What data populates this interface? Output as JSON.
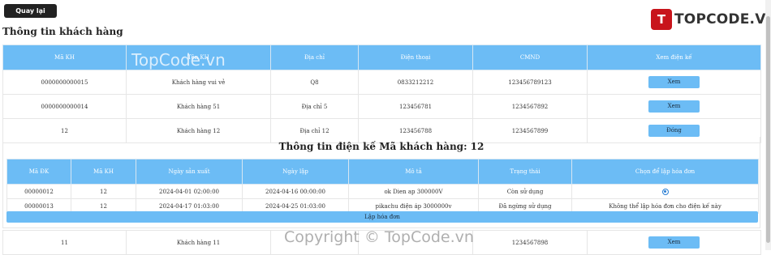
{
  "header": {
    "back_label": "Quay lại",
    "logo_mark": "T",
    "logo_text": "TOPCODE.VN",
    "page_title": "Thông tin khách hàng"
  },
  "customer_table": {
    "columns": [
      "Mã KH",
      "Tên KH",
      "Địa chỉ",
      "Điện thoại",
      "CMND",
      "Xem điện kế"
    ],
    "rows": [
      {
        "id": "0000000000015",
        "name": "Khách hàng vui vẻ",
        "address": "Q8",
        "phone": "0833212212",
        "cmnd": "123456789123",
        "action": "Xem"
      },
      {
        "id": "0000000000014",
        "name": "Khách hàng 51",
        "address": "Địa chỉ 5",
        "phone": "123456781",
        "cmnd": "1234567892",
        "action": "Xem"
      },
      {
        "id": "12",
        "name": "Khách hàng 12",
        "address": "Địa chỉ 12",
        "phone": "123456788",
        "cmnd": "1234567899",
        "action": "Đóng"
      }
    ],
    "last_row": {
      "id": "11",
      "name": "Khách hàng 11",
      "address": "",
      "phone": "",
      "cmnd": "1234567898",
      "action": "Xem"
    }
  },
  "meter_section": {
    "title": "Thông tin điện kế Mã khách hàng: 12",
    "columns": [
      "Mã ĐK",
      "Mã KH",
      "Ngày sản xuất",
      "Ngày lập",
      "Mô tả",
      "Trạng thái",
      "Chọn để lập hóa đơn"
    ],
    "rows": [
      {
        "meter_id": "00000012",
        "customer_id": "12",
        "produced": "2024-04-01 02:00:00",
        "created": "2024-04-16 00:00:00",
        "description": "ok Dien ap 300000V",
        "status": "Còn sử dụng",
        "select": "radio"
      },
      {
        "meter_id": "00000013",
        "customer_id": "12",
        "produced": "2024-04-17 01:03:00",
        "created": "2024-04-25 01:03:00",
        "description": "pikachu điện áp 3000000v",
        "status": "Đã ngừng sử dụng",
        "select_text": "Không thể lập hóa đơn cho điện kế này"
      }
    ],
    "invoice_button": "Lập hóa đơn"
  },
  "watermarks": {
    "top": "TopCode.vn",
    "bottom": "Copyright © TopCode.vn"
  }
}
